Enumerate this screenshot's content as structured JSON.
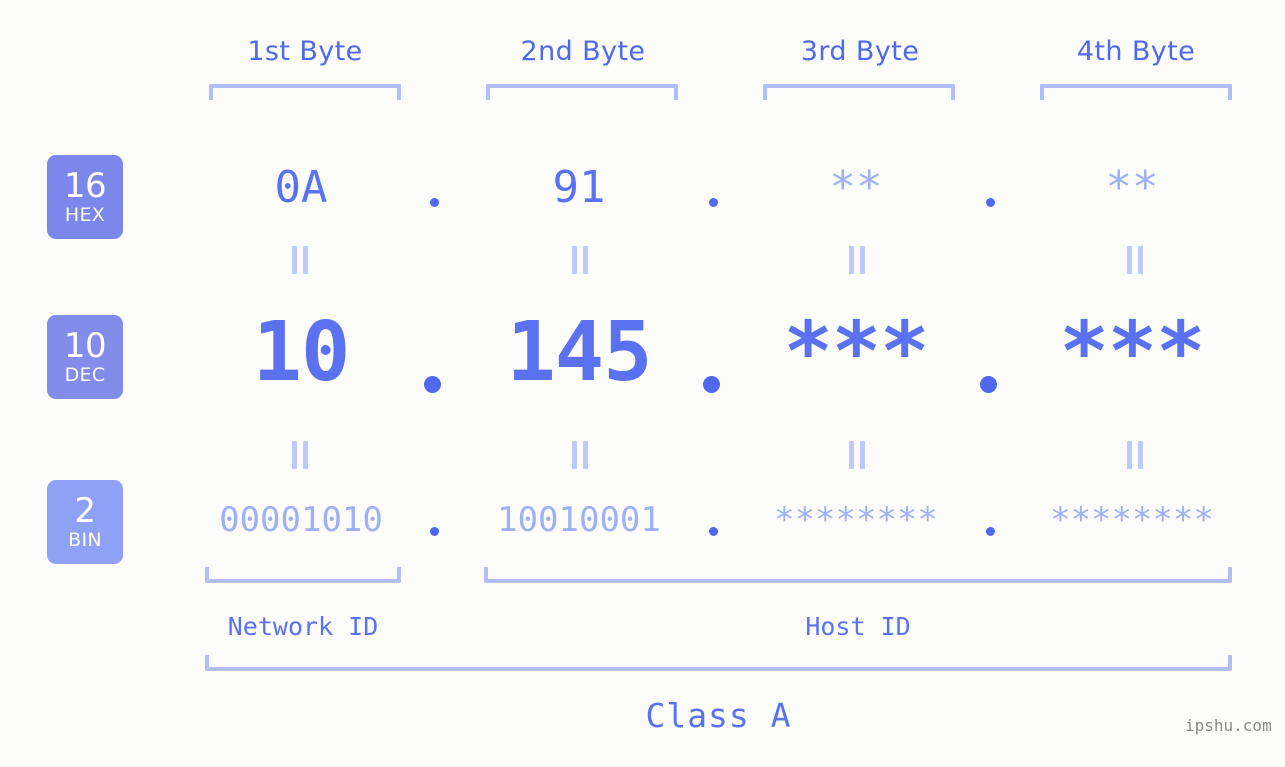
{
  "meta": {
    "background_color": "#fcfdfa",
    "accent_color": "#5b72f0",
    "accent_muted_color": "#9fb0f7",
    "bracket_color": "#b3bdfb",
    "watermark": "ipshu.com"
  },
  "header": {
    "byte_labels": [
      "1st Byte",
      "2nd Byte",
      "3rd Byte",
      "4th Byte"
    ]
  },
  "rows": [
    {
      "badge": {
        "number": "16",
        "name": "HEX"
      },
      "values": [
        "0A",
        "91",
        "**",
        "**"
      ],
      "known": [
        true,
        true,
        false,
        false
      ],
      "separator": "."
    },
    {
      "badge": {
        "number": "10",
        "name": "DEC"
      },
      "values": [
        "10",
        "145",
        "***",
        "***"
      ],
      "known": [
        true,
        true,
        true,
        true
      ],
      "separator": "."
    },
    {
      "badge": {
        "number": "2",
        "name": "BIN"
      },
      "values": [
        "00001010",
        "10010001",
        "********",
        "********"
      ],
      "known": [
        false,
        false,
        false,
        false
      ],
      "separator": "."
    }
  ],
  "footer": {
    "network_id_label": "Network ID",
    "host_id_label": "Host ID",
    "class_label": "Class A"
  },
  "chart_data": {
    "type": "table",
    "title": "IPv4 address byte breakdown",
    "columns": [
      "1st Byte",
      "2nd Byte",
      "3rd Byte",
      "4th Byte"
    ],
    "rows": [
      {
        "radix": 16,
        "radix_name": "HEX",
        "cells": [
          "0A",
          "91",
          "**",
          "**"
        ]
      },
      {
        "radix": 10,
        "radix_name": "DEC",
        "cells": [
          "10",
          "145",
          "***",
          "***"
        ]
      },
      {
        "radix": 2,
        "radix_name": "BIN",
        "cells": [
          "00001010",
          "10010001",
          "********",
          "********"
        ]
      }
    ],
    "groups": [
      {
        "label": "Network ID",
        "bytes": [
          1
        ]
      },
      {
        "label": "Host ID",
        "bytes": [
          2,
          3,
          4
        ]
      }
    ],
    "class": "Class A"
  }
}
